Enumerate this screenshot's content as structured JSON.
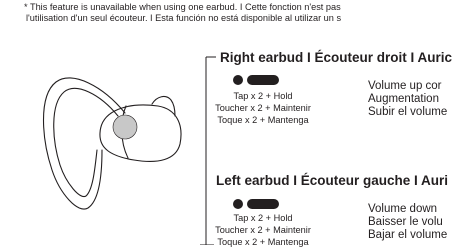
{
  "notice": {
    "line1": "* This feature is unavailable when using one earbud. I Cette fonction n'est pas",
    "line2": "l'utilisation d'un seul écouteur. I Esta función no está disponible al utilizar un s"
  },
  "right": {
    "title": "Right earbud I Écouteur droit I Auric",
    "gesture": [
      "Tap x 2 + Hold",
      "Toucher x 2 + Maintenir",
      "Toque x 2 + Mantenga"
    ],
    "action": [
      "Volume up cor",
      "Augmentation",
      "Subir el volume"
    ]
  },
  "left": {
    "title": "Left earbud I Écouteur gauche I Auri",
    "gesture": [
      "Tap x 2 + Hold",
      "Toucher x 2 + Maintenir",
      "Toque x 2 + Mantenga"
    ],
    "action": [
      "Volume down",
      "Baisser le volu",
      "Bajar el volume"
    ]
  }
}
